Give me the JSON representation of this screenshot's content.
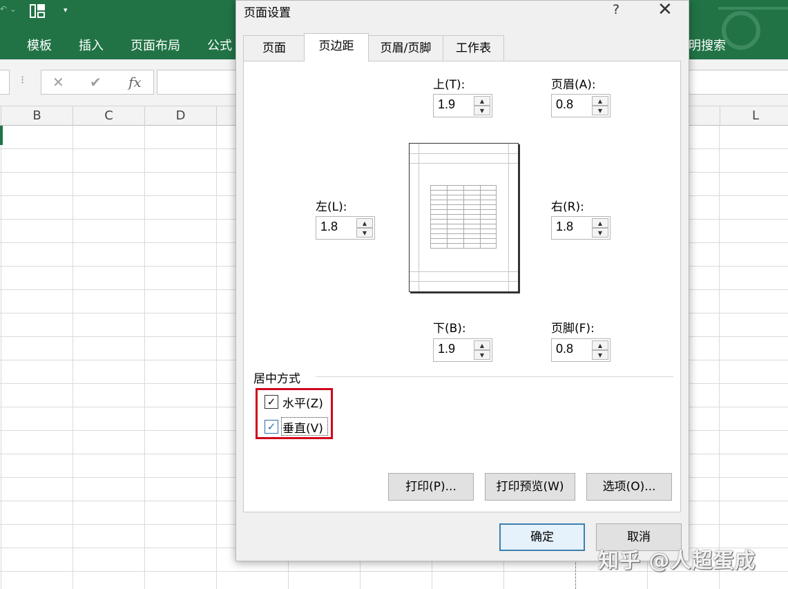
{
  "ribbon": {
    "tabs": [
      "模板",
      "插入",
      "页面布局",
      "公式"
    ],
    "tell_me_text": "明搜索"
  },
  "formula_bar": {
    "cancel": "✕",
    "enter": "✔",
    "fx": "fx"
  },
  "columns": [
    "B",
    "C",
    "D",
    "L"
  ],
  "dialog": {
    "title": "页面设置",
    "help": "?",
    "close": "✕",
    "tabs": [
      "页面",
      "页边距",
      "页眉/页脚",
      "工作表"
    ],
    "active_tab": "页边距",
    "margins": {
      "top": {
        "label": "上(T):",
        "value": "1.9"
      },
      "header": {
        "label": "页眉(A):",
        "value": "0.8"
      },
      "left": {
        "label": "左(L):",
        "value": "1.8"
      },
      "right": {
        "label": "右(R):",
        "value": "1.8"
      },
      "bottom": {
        "label": "下(B):",
        "value": "1.9"
      },
      "footer": {
        "label": "页脚(F):",
        "value": "0.8"
      }
    },
    "centering": {
      "group_label": "居中方式",
      "horizontal": {
        "label": "水平(Z)",
        "checked": true
      },
      "vertical": {
        "label": "垂直(V)",
        "checked": true
      }
    },
    "buttons": {
      "print": "打印(P)...",
      "print_preview": "打印预览(W)",
      "options": "选项(O)...",
      "ok": "确定",
      "cancel": "取消"
    }
  },
  "watermark": "知乎 @人超蛋成"
}
